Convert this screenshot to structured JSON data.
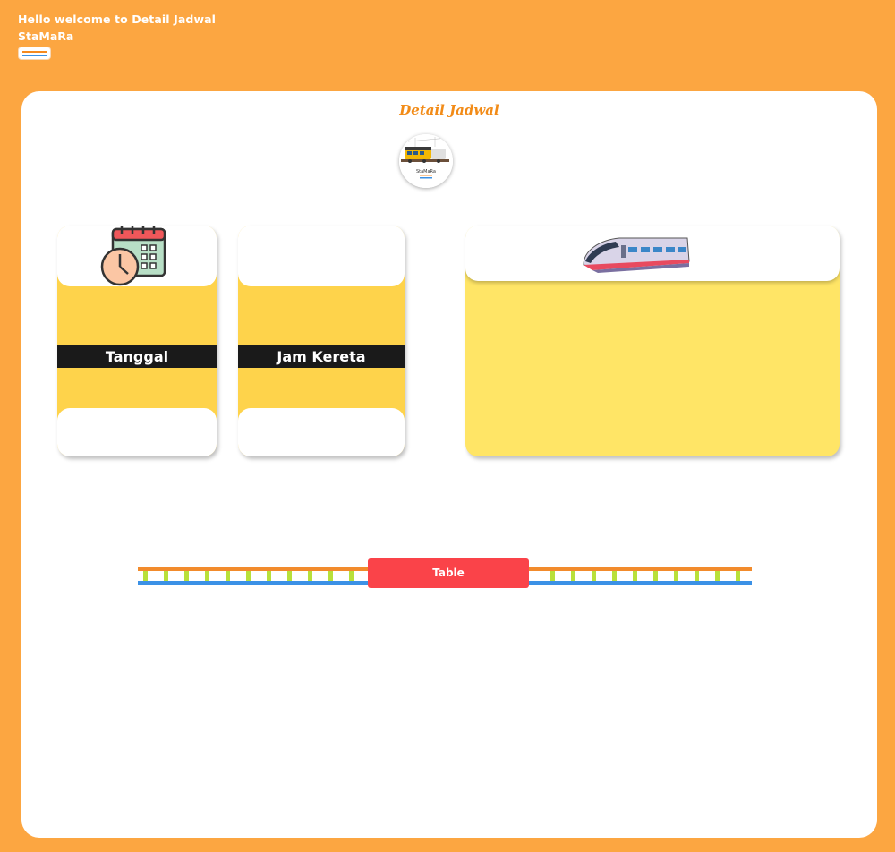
{
  "header": {
    "welcome": "Hello welcome to Detail Jadwal",
    "brand": "StaMaRa"
  },
  "main": {
    "title": "Detail Jadwal",
    "logo_caption": "StaMaRa"
  },
  "cards": {
    "date_label": "Tanggal",
    "time_label": "Jam Kereta"
  },
  "table_button": "Table",
  "icons": {
    "mini_rail": "rail-icon",
    "logo": "train-logo-icon",
    "calendar": "calendar-clock-icon",
    "train": "bullet-train-icon"
  },
  "colors": {
    "background": "#fca641",
    "title": "#f28b17",
    "card_yellow": "#fed34b",
    "train_card_yellow": "#ffe566",
    "button_red": "#fa4349",
    "rail_orange": "#f28b2c",
    "rail_blue": "#3b91e6",
    "tie_green": "#b8e03a"
  }
}
